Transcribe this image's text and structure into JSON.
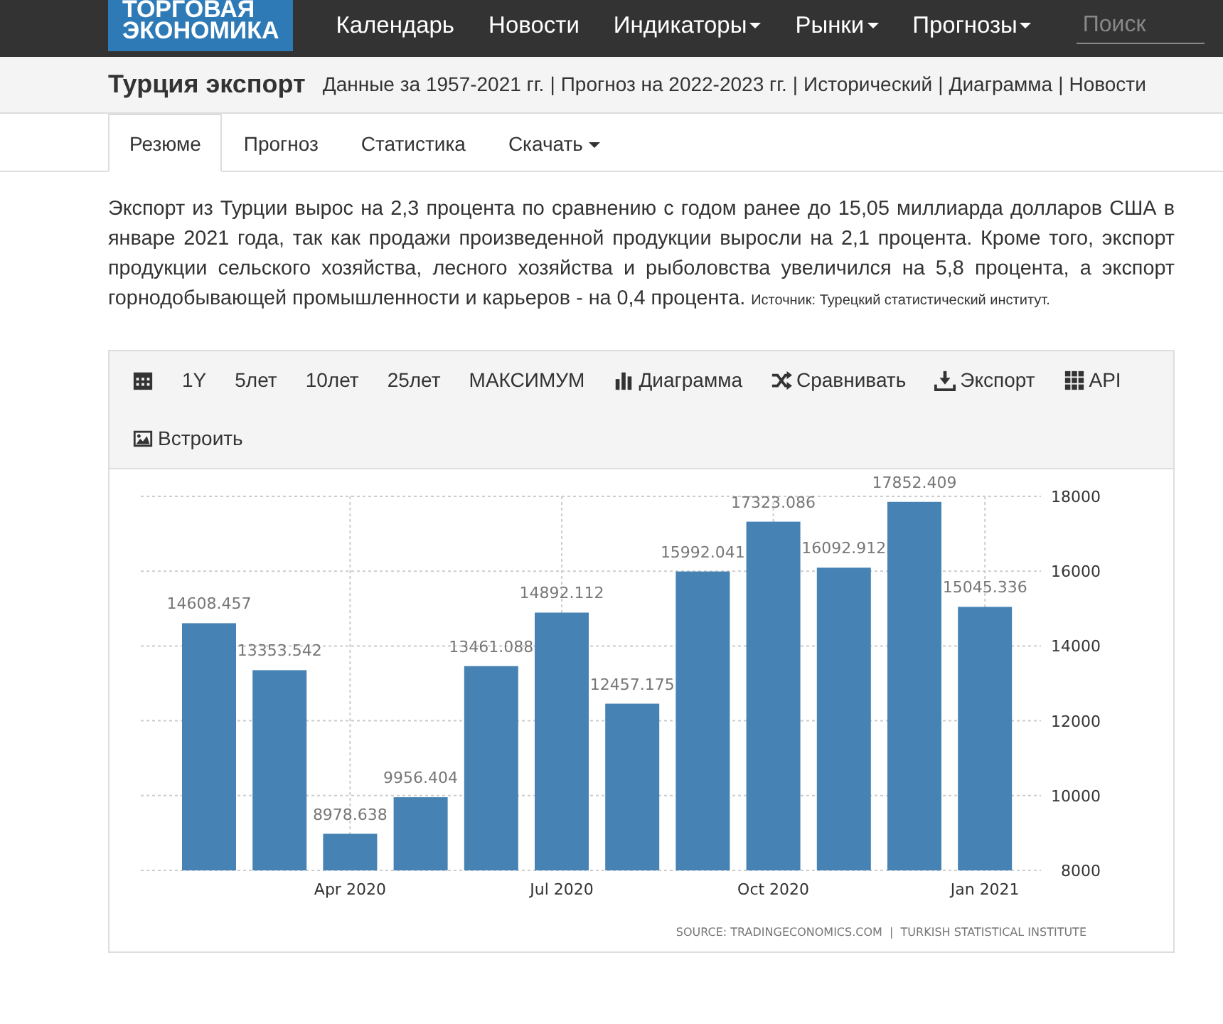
{
  "navbar": {
    "logo": [
      "ТОРГОВАЯ",
      "ЭКОНОМИКА"
    ],
    "items": [
      {
        "label": "Календарь",
        "dropdown": false
      },
      {
        "label": "Новости",
        "dropdown": false
      },
      {
        "label": "Индикаторы",
        "dropdown": true
      },
      {
        "label": "Рынки",
        "dropdown": true
      },
      {
        "label": "Прогнозы",
        "dropdown": true
      }
    ],
    "search": {
      "placeholder": "Поиск"
    }
  },
  "header": {
    "title": "Турция экспорт",
    "links": [
      {
        "kind": "link",
        "label": "Данные за 1957-2021 гг."
      },
      {
        "kind": "separator",
        "label": "|"
      },
      {
        "kind": "link",
        "label": "Прогноз на 2022-2023 гг."
      },
      {
        "kind": "separator",
        "label": "|"
      },
      {
        "kind": "link",
        "label": "Исторический"
      },
      {
        "kind": "separator",
        "label": "|"
      },
      {
        "kind": "link",
        "label": "Диаграмма"
      },
      {
        "kind": "separator",
        "label": "|"
      },
      {
        "kind": "link",
        "label": "Новости"
      }
    ]
  },
  "tabs": [
    {
      "label": "Резюме",
      "selected": true,
      "dropdown": false
    },
    {
      "label": "Прогноз",
      "selected": false,
      "dropdown": false
    },
    {
      "label": "Статистика",
      "selected": false,
      "dropdown": false
    },
    {
      "label": "Скачать",
      "selected": false,
      "dropdown": true
    }
  ],
  "summary": {
    "text": "Экспорт из Турции вырос на 2,3 процента по сравнению с годом ранее до 15,05 миллиарда долларов США в январе 2021 года, так как продажи произведенной продукции выросли на 2,1 процента. Кроме того, экспорт продукции сельского хозяйства, лесного хозяйства и рыболовства увеличился на 5,8 процента, а экспорт горнодобывающей промышленности и карьеров - на 0,4 процента.",
    "source": "Источник: Турецкий статистический институт."
  },
  "toolbar": [
    {
      "kind": "calendar"
    },
    {
      "kind": "text",
      "label": "1Y"
    },
    {
      "kind": "text",
      "label": "5лет"
    },
    {
      "kind": "text",
      "label": "10лет"
    },
    {
      "kind": "text",
      "label": "25лет"
    },
    {
      "kind": "text",
      "label": "МАКСИМУМ"
    },
    {
      "kind": "chart",
      "label": "Диаграмма"
    },
    {
      "kind": "compare",
      "label": "Сравнивать"
    },
    {
      "kind": "export",
      "label": "Экспорт"
    },
    {
      "kind": "api",
      "label": "API"
    },
    {
      "kind": "embed",
      "label": "Встроить"
    }
  ],
  "chart": {
    "source": "SOURCE: TRADINGECONOMICS.COM  |  TURKISH STATISTICAL INSTITUTE",
    "chart_data": {
      "type": "bar",
      "data_labels": true,
      "grid": true,
      "ylim": [
        8000,
        18000
      ],
      "yticks": [
        8000,
        10000,
        12000,
        14000,
        16000,
        18000
      ],
      "categories": [
        null,
        null,
        "Apr 2020",
        null,
        null,
        "Jul 2020",
        null,
        null,
        "Oct 2020",
        null,
        null,
        "Jan 2021"
      ],
      "series": [
        {
          "color": "#4682b4",
          "values": [
            14608.457,
            13353.542,
            8978.638,
            9956.404,
            13461.088,
            14892.112,
            12457.175,
            15992.041,
            17323.086,
            16092.912,
            17852.409,
            15045.336
          ]
        }
      ]
    }
  }
}
